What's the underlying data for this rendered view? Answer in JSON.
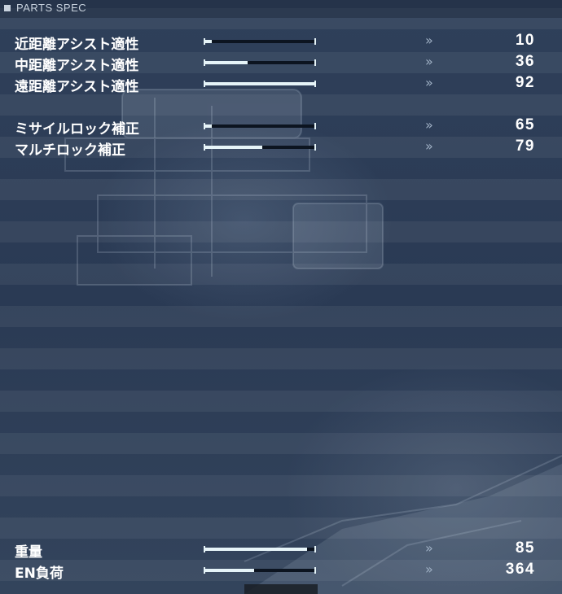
{
  "header": {
    "title": "PARTS SPEC"
  },
  "stats": [
    {
      "label": "近距離アシスト適性",
      "value": "10",
      "level": 0.06
    },
    {
      "label": "中距離アシスト適性",
      "value": "36",
      "level": 0.39
    },
    {
      "label": "遠距離アシスト適性",
      "value": "92",
      "level": 1.0
    },
    {
      "label": "ミサイルロック補正",
      "value": "65",
      "level": 0.06
    },
    {
      "label": "マルチロック補正",
      "value": "79",
      "level": 0.52
    },
    {
      "label": "重量",
      "value": "85",
      "level": 0.93
    },
    {
      "label": "EN負荷",
      "value": "364",
      "level": 0.45
    }
  ],
  "colors": {
    "background": "#2a3a52",
    "bar_fill": "#e6f4f8",
    "bar_track": "#0c1420",
    "arrow": "#9fb0c4"
  },
  "icons": {
    "header_marker": "square-icon",
    "row_arrow": "double-chevron-right-icon"
  }
}
